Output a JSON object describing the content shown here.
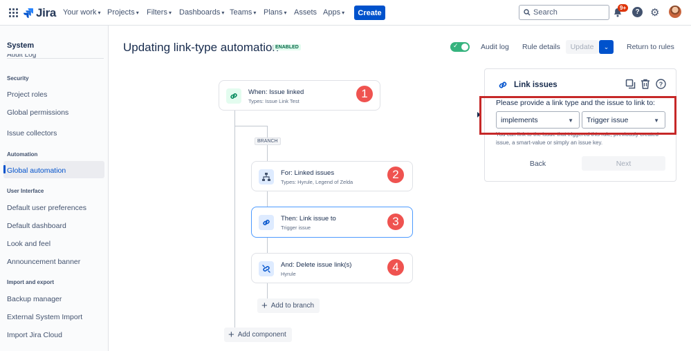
{
  "nav": {
    "brand": "Jira",
    "items": [
      "Your work",
      "Projects",
      "Filters",
      "Dashboards",
      "Teams",
      "Plans",
      "Assets",
      "Apps"
    ],
    "create_label": "Create",
    "search_placeholder": "Search",
    "notifications_badge": "9+"
  },
  "sidebar": {
    "title": "System",
    "cut_item": "Audit Log",
    "sections": [
      {
        "heading": "Security",
        "items": [
          "Project roles",
          "Global permissions",
          "Issue collectors"
        ]
      },
      {
        "heading": "Automation",
        "items": [
          "Global automation"
        ]
      },
      {
        "heading": "User Interface",
        "items": [
          "Default user preferences",
          "Default dashboard",
          "Look and feel",
          "Announcement banner"
        ]
      },
      {
        "heading": "Import and export",
        "items": [
          "Backup manager",
          "External System Import",
          "Import Jira Cloud"
        ]
      }
    ],
    "active_item": "Global automation",
    "bottom_cut": "Import Jira Cloud"
  },
  "header": {
    "title": "Updating link-type automation",
    "status": "ENABLED",
    "audit_log": "Audit log",
    "rule_details": "Rule details",
    "update": "Update",
    "return": "Return to rules"
  },
  "flow": {
    "trigger": {
      "title": "When: Issue linked",
      "sub": "Types: Issue Link Test",
      "num": "1"
    },
    "branch_tag": "BRANCH",
    "branch": {
      "title": "For: Linked issues",
      "sub": "Types: Hyrule, Legend of Zelda",
      "num": "2"
    },
    "action1": {
      "title": "Then: Link issue to",
      "sub": "Trigger issue",
      "num": "3"
    },
    "action2": {
      "title": "And: Delete issue link(s)",
      "sub": "Hyrule",
      "num": "4"
    },
    "add_to_branch": "Add to branch",
    "add_component": "Add component"
  },
  "panel": {
    "title": "Link issues",
    "label": "Please provide a link type and the issue to link to:",
    "link_type": "implements",
    "target": "Trigger issue",
    "help": "You can link to the issue that triggered this rule, previously created issue, a smart-value or simply an issue key.",
    "back": "Back",
    "next": "Next"
  },
  "colors": {
    "accent": "#0052cc",
    "number_badge": "#ef5350",
    "highlight": "#c62828"
  }
}
